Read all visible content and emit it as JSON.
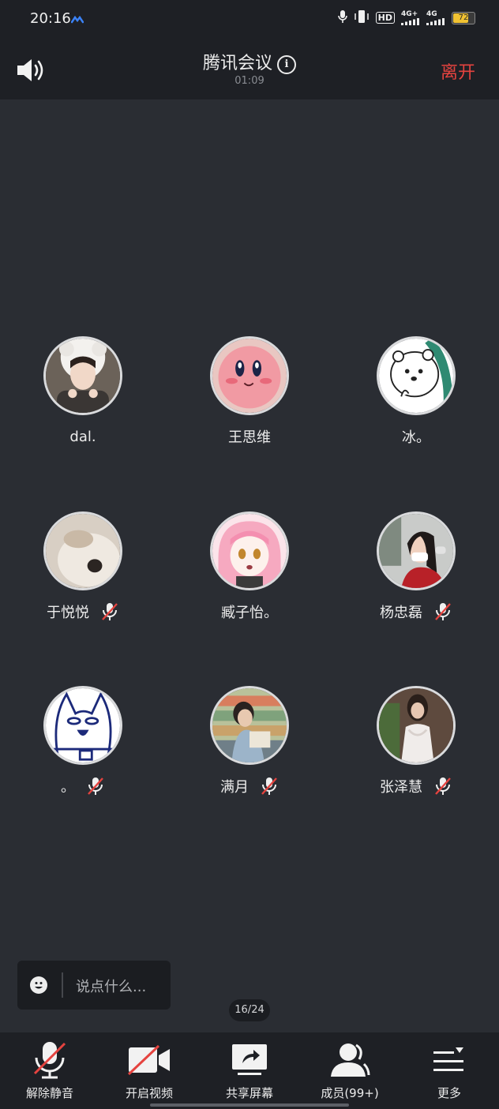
{
  "status_bar": {
    "time": "20:16",
    "network_label": "HD",
    "signal1": "4G+",
    "signal2": "4G",
    "battery": "72",
    "battery_level": 0.72
  },
  "header": {
    "title": "腾讯会议",
    "timer": "01:09",
    "leave_label": "离开"
  },
  "participants": [
    {
      "name": "dal.",
      "muted": false
    },
    {
      "name": "王思维",
      "muted": false
    },
    {
      "name": "冰。",
      "muted": false
    },
    {
      "name": "于悦悦",
      "muted": true
    },
    {
      "name": "臧子怡。",
      "muted": false
    },
    {
      "name": "杨忠磊",
      "muted": true
    },
    {
      "name": "。",
      "muted": true
    },
    {
      "name": "满月",
      "muted": true
    },
    {
      "name": "张泽慧",
      "muted": true
    }
  ],
  "chat": {
    "placeholder": "说点什么..."
  },
  "page_indicator": "16/24",
  "toolbar": {
    "unmute_label": "解除静音",
    "video_label": "开启视频",
    "share_label": "共享屏幕",
    "members_label": "成员(99+)",
    "more_label": "更多"
  },
  "colors": {
    "background": "#2a2d33",
    "bar": "#1e2025",
    "leave": "#e5433f",
    "mute_slash": "#e5433f"
  }
}
